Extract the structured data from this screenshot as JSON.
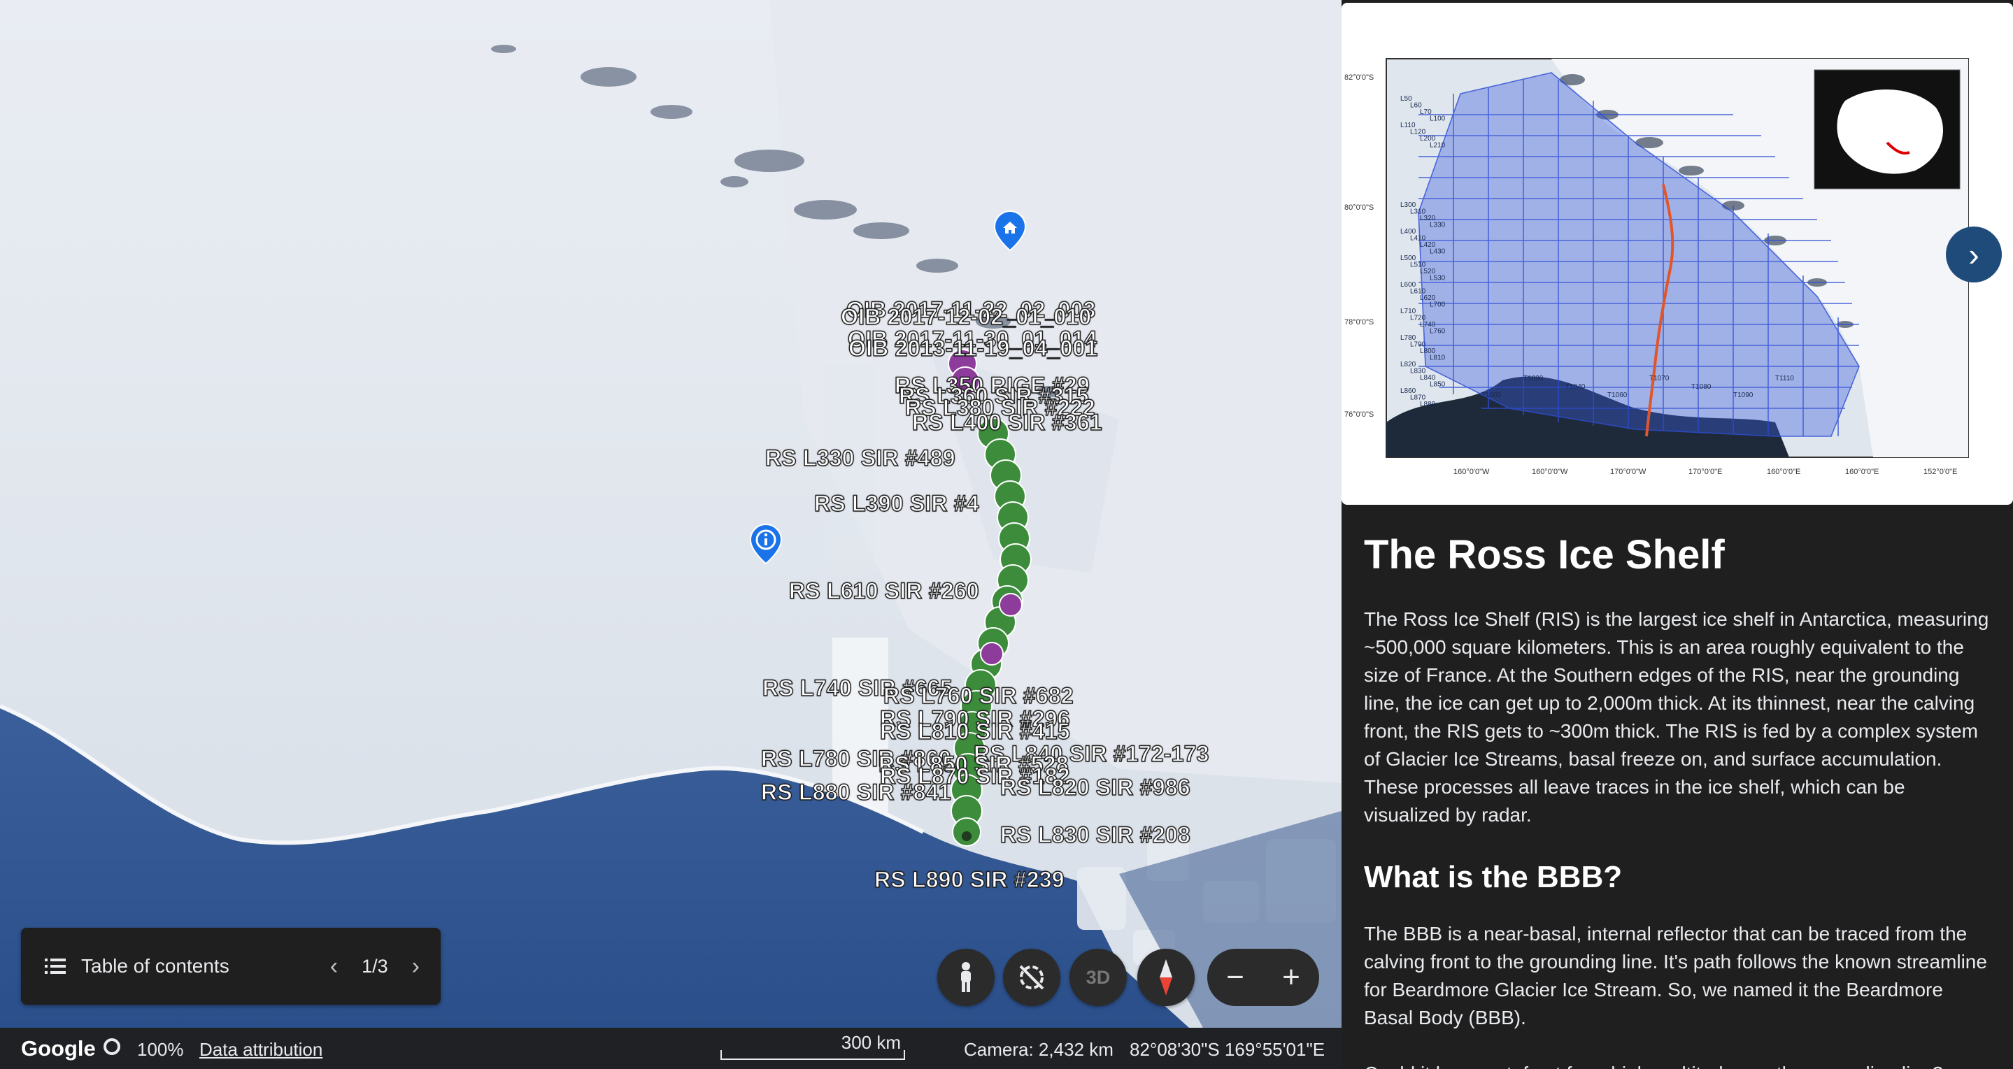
{
  "map": {
    "pin_labels": [
      "OIB 2017-11-22_02_003",
      "OIB 2017-12-02_01_010",
      "OIB 2017-11-30_01_014",
      "OIB 2013-11-19_04_001",
      "RS L350 RIGE #29",
      "RS L360 SIR #315",
      "RS L380 SIR #222",
      "RS L400 SIR #361",
      "RS L330 SIR #489",
      "RS L390 SIR #4",
      "RS L610 SIR #260",
      "RS L740 SIR #665",
      "RS L760 SIR #682",
      "RS L790 SIR #296",
      "RS L810 SIR #415",
      "RS L840 SIR #172-173",
      "RS L780 SIR #860",
      "RS L850 SIR #528",
      "RS L870 SIR #182",
      "RS L820 SIR #986",
      "RS L880 SIR #841",
      "RS L830 SIR #208",
      "RS L890 SIR #239"
    ]
  },
  "toc": {
    "label": "Table of contents",
    "page": "1/3"
  },
  "controls": {
    "three_d": "3D",
    "zoom_out": "−",
    "zoom_in": "+"
  },
  "status": {
    "logo": "Google",
    "percent": "100%",
    "attribution": "Data attribution",
    "scale": "300 km",
    "camera": "Camera: 2,432 km",
    "coordinates": "82°08'30\"S 169°55'01\"E"
  },
  "panel": {
    "title": "The Ross Ice Shelf",
    "paragraph1": "The Ross Ice Shelf (RIS) is the largest ice shelf in Antarctica, measuring ~500,000 square kilometers. This is an area roughly equivalent to the size of France. At the Southern edges of the RIS, near the grounding line, the ice can get up to 2,000m thick. At its thinnest, near the calving front, the RIS gets to ~300m thick. The RIS is fed by a complex system of Glacier Ice Streams, basal freeze on, and surface accumulation. These processes all leave traces in the ice shelf, which can be visualized by radar.",
    "heading2": "What is the BBB?",
    "paragraph2": "The BBB is a near-basal, internal reflector that can be traced from the calving front to the grounding line. It's path follows the known streamline for Beardmore Glacier Ice Stream. So, we named it the Beardmore Basal Body (BBB).",
    "paragraph3_partial": "Could it be a metafract from higher altitudes on the grounding line?",
    "figure": {
      "lat_labels": [
        "82°0'0\"S",
        "80°0'0\"S",
        "78°0'0\"S",
        "76°0'0\"S"
      ],
      "lon_labels": [
        "160°0'0\"W",
        "160°0'0\"W",
        "170°0'0\"W",
        "170°0'0\"E",
        "160°0'0\"E",
        "160°0'0\"E",
        "152°0'0\"E"
      ],
      "line_labels": [
        "L50",
        "L60",
        "L70",
        "L100",
        "L110",
        "L120",
        "L200",
        "L210",
        "T1000",
        "T1020",
        "T1040",
        "T1060",
        "T1070",
        "T1080",
        "T1090",
        "T1110",
        "L300",
        "L310",
        "L320",
        "L330",
        "L400",
        "L410",
        "L420",
        "L430",
        "L500",
        "L510",
        "L520",
        "L530",
        "L600",
        "L610",
        "L620",
        "L700",
        "L710",
        "L720",
        "L740",
        "L760",
        "L780",
        "L790",
        "L800",
        "L810",
        "L820",
        "L830",
        "L840",
        "L850",
        "L860",
        "L870",
        "L880"
      ]
    }
  }
}
